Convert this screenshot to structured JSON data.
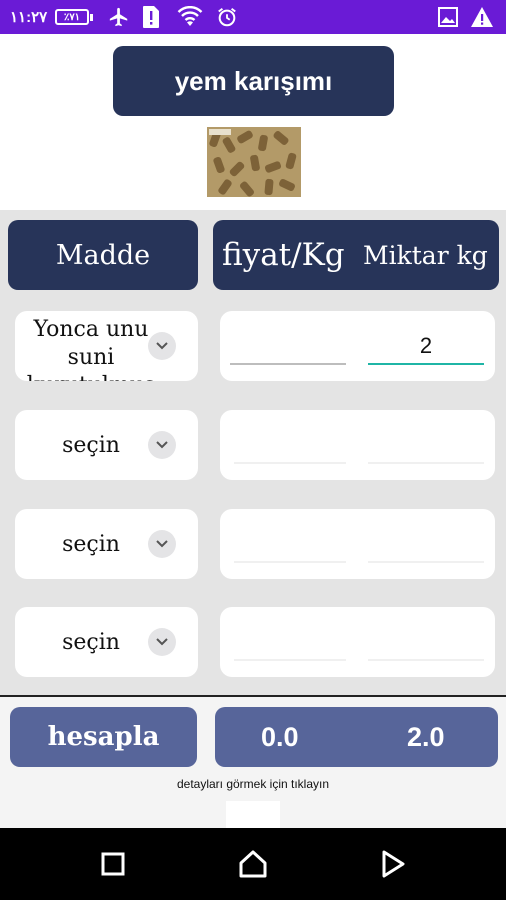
{
  "status_bar": {
    "time": "١١:٢٧",
    "battery_label": "٪٧١",
    "icons": [
      "airplane-icon",
      "sim-alert-icon",
      "wifi-icon",
      "alarm-icon",
      "image-icon",
      "warning-icon"
    ]
  },
  "header": {
    "title": "yem karışımı",
    "image_alt": "feed-pellets-image"
  },
  "table": {
    "column_madde": "Madde",
    "column_price": "fiyat/Kg",
    "column_amount": "Miktar kg",
    "rows": [
      {
        "select_label": "Yonca unu suni kurutulmuş",
        "price": "",
        "amount": "2"
      },
      {
        "select_label": "seçin",
        "price": "",
        "amount": ""
      },
      {
        "select_label": "seçin",
        "price": "",
        "amount": ""
      },
      {
        "select_label": "seçin",
        "price": "",
        "amount": ""
      }
    ]
  },
  "footer": {
    "calculate_label": "hesapla",
    "total_price": "0.0",
    "total_amount": "2.0",
    "details_link": "detayları görmek için tıklayın"
  },
  "colors": {
    "status_bar": "#6a1bd6",
    "dark_navy": "#273459",
    "button_blue": "#57659a",
    "active_underline": "#1fb5a6"
  }
}
